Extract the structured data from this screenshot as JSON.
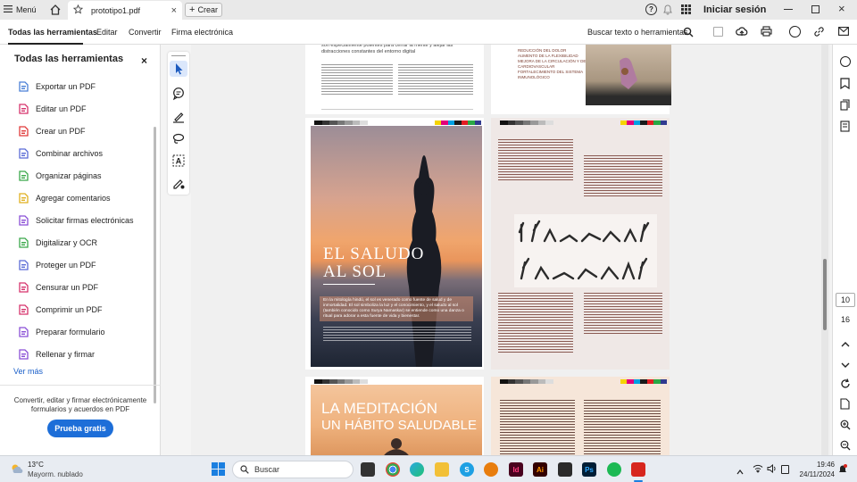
{
  "titlebar": {
    "menu_label": "Menú",
    "tab_title": "prototipo1.pdf",
    "create_label": "Crear",
    "signin_label": "Iniciar sesión"
  },
  "toolbar": {
    "tabs": [
      "Todas las herramientas",
      "Editar",
      "Convertir",
      "Firma electrónica"
    ],
    "search_label": "Buscar texto o herramientas"
  },
  "left_panel": {
    "title": "Todas las herramientas",
    "items": [
      {
        "label": "Exportar un PDF",
        "icon": "export-pdf-icon",
        "color": "#4a7fd6"
      },
      {
        "label": "Editar un PDF",
        "icon": "edit-pdf-icon",
        "color": "#d6336c"
      },
      {
        "label": "Crear un PDF",
        "icon": "create-pdf-icon",
        "color": "#e03b3b"
      },
      {
        "label": "Combinar archivos",
        "icon": "combine-files-icon",
        "color": "#5a6bd6"
      },
      {
        "label": "Organizar páginas",
        "icon": "organize-pages-icon",
        "color": "#3aa84a"
      },
      {
        "label": "Agregar comentarios",
        "icon": "comment-icon",
        "color": "#e0b020"
      },
      {
        "label": "Solicitar firmas electrónicas",
        "icon": "request-signature-icon",
        "color": "#8a4fd6"
      },
      {
        "label": "Digitalizar y OCR",
        "icon": "scan-ocr-icon",
        "color": "#3aa84a"
      },
      {
        "label": "Proteger un PDF",
        "icon": "protect-pdf-icon",
        "color": "#5a6bd6"
      },
      {
        "label": "Censurar un PDF",
        "icon": "redact-pdf-icon",
        "color": "#d6336c"
      },
      {
        "label": "Comprimir un PDF",
        "icon": "compress-pdf-icon",
        "color": "#d6336c"
      },
      {
        "label": "Preparar formulario",
        "icon": "prepare-form-icon",
        "color": "#8a4fd6"
      },
      {
        "label": "Rellenar y firmar",
        "icon": "fill-sign-icon",
        "color": "#8a4fd6"
      }
    ],
    "more_label": "Ver más",
    "promo_text": "Convertir, editar y firmar electrónicamente formularios y acuerdos en PDF",
    "trial_label": "Prueba gratis"
  },
  "document": {
    "page_top_left_text": "son especialmente potentes para cerrar la mente y alejar las distracciones constantes del entorno digital",
    "page_top_right_list": [
      "REDUCCIÓN DEL DOLOR",
      "AUMENTO DE LA FLEXIBILIDAD",
      "MEJORA DE LA CIRCULACIÓN Y DE LA SALUD CARDIOVASCULAR",
      "FORTALECIMIENTO DEL SISTEMA INMUNOLÓGICO"
    ],
    "saludo_title_1": "EL SALUDO",
    "saludo_title_2": "AL SOL",
    "saludo_body": "En la mitología hindú, el sol es venerado como fuente de salud y de inmortalidad. El sol simboliza la luz y el conocimiento, y el saludo al sol (también conocido como Surya Namaskar) se entiende como una danza o ritual para adorar a esta fuente de vida y bienestar.",
    "meditacion_title_1": "LA MEDITACIÓN",
    "meditacion_title_2": "UN HÁBITO SALUDABLE"
  },
  "page_nav": {
    "current_page": "10",
    "total_pages": "16"
  },
  "taskbar": {
    "temperature": "13°C",
    "weather": "Mayorm. nublado",
    "search_label": "Buscar",
    "time": "19:46",
    "date": "24/11/2024"
  }
}
